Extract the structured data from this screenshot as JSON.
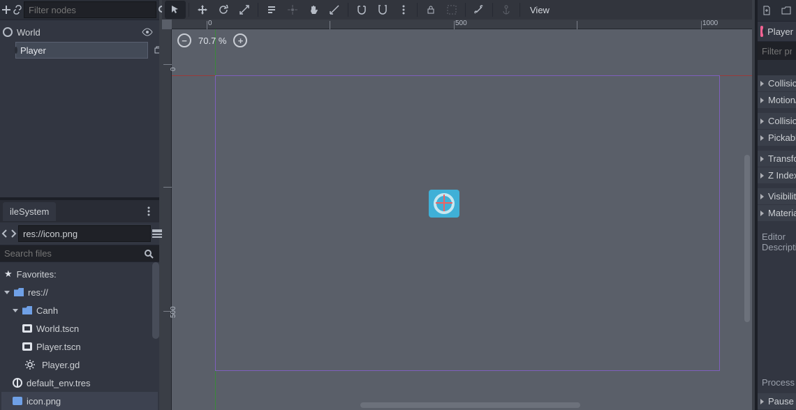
{
  "scene_panel": {
    "filter_placeholder": "Filter nodes",
    "nodes": {
      "root": {
        "name": "World"
      },
      "selected": {
        "name_value": "Player"
      }
    }
  },
  "filesystem": {
    "tab_label": "ileSystem",
    "path_value": "res://icon.png",
    "search_placeholder": "Search files",
    "favorites_label": "Favorites:",
    "res_label": "res://",
    "folders": {
      "canh": "Canh"
    },
    "files": {
      "world": "World.tscn",
      "player_scene": "Player.tscn",
      "player_script": "Player.gd",
      "env": "default_env.tres",
      "icon": "icon.png"
    }
  },
  "toolbar": {
    "view_label": "View"
  },
  "viewport": {
    "zoom_text": "70.7 %",
    "ruler": {
      "h": {
        "t0": "0",
        "t500": "500",
        "t1000": "1000"
      },
      "v": {
        "t0": "0",
        "t500": "500"
      }
    }
  },
  "inspector": {
    "node_name": "Player",
    "filter_placeholder": "Filter properties",
    "rows": {
      "collision1": "Collision",
      "motion": "Motion/Sync",
      "collision2": "Collision",
      "pickable": "Pickable",
      "transform": "Transform",
      "zindex": "Z Index",
      "visibility": "Visibility",
      "material": "Material",
      "pause": "Pause"
    },
    "editor_desc": "Editor Description",
    "process": "Process"
  }
}
